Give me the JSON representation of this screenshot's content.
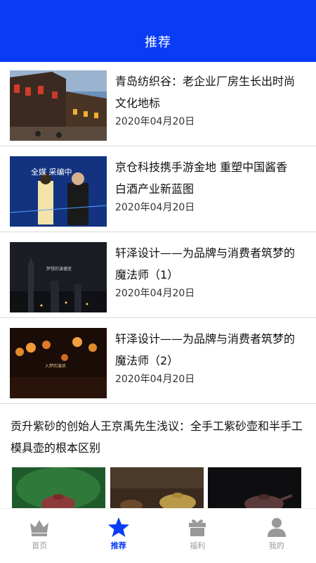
{
  "header": {
    "title": "推荐"
  },
  "articles": [
    {
      "title": "青岛纺织谷：老企业厂房生长出时尚文化地标",
      "date": "2020年04月20日"
    },
    {
      "title": "京仓科技携手游金地 重塑中国酱香白酒产业新蓝图",
      "date": "2020年04月20日"
    },
    {
      "title": "轩泽设计——为品牌与消费者筑梦的魔法师（1）",
      "date": "2020年04月20日"
    },
    {
      "title": "轩泽设计——为品牌与消费者筑梦的魔法师（2）",
      "date": "2020年04月20日"
    }
  ],
  "big_article": {
    "title": "贡升紫砂的创始人王京禹先生浅议：全手工紫砂壶和半手工模具壶的根本区别"
  },
  "thumb_text": {
    "a2_banner": "全媒 采编中",
    "a3_sign": "梦想的演播室",
    "a4_sign": "入梦的演员"
  },
  "tabs": [
    {
      "label": "首页",
      "icon": "crown-icon"
    },
    {
      "label": "推荐",
      "icon": "star-icon",
      "active": true
    },
    {
      "label": "福利",
      "icon": "gift-icon"
    },
    {
      "label": "我的",
      "icon": "user-icon"
    }
  ],
  "colors": {
    "primary": "#0a3cf5",
    "inactive": "#999999"
  }
}
